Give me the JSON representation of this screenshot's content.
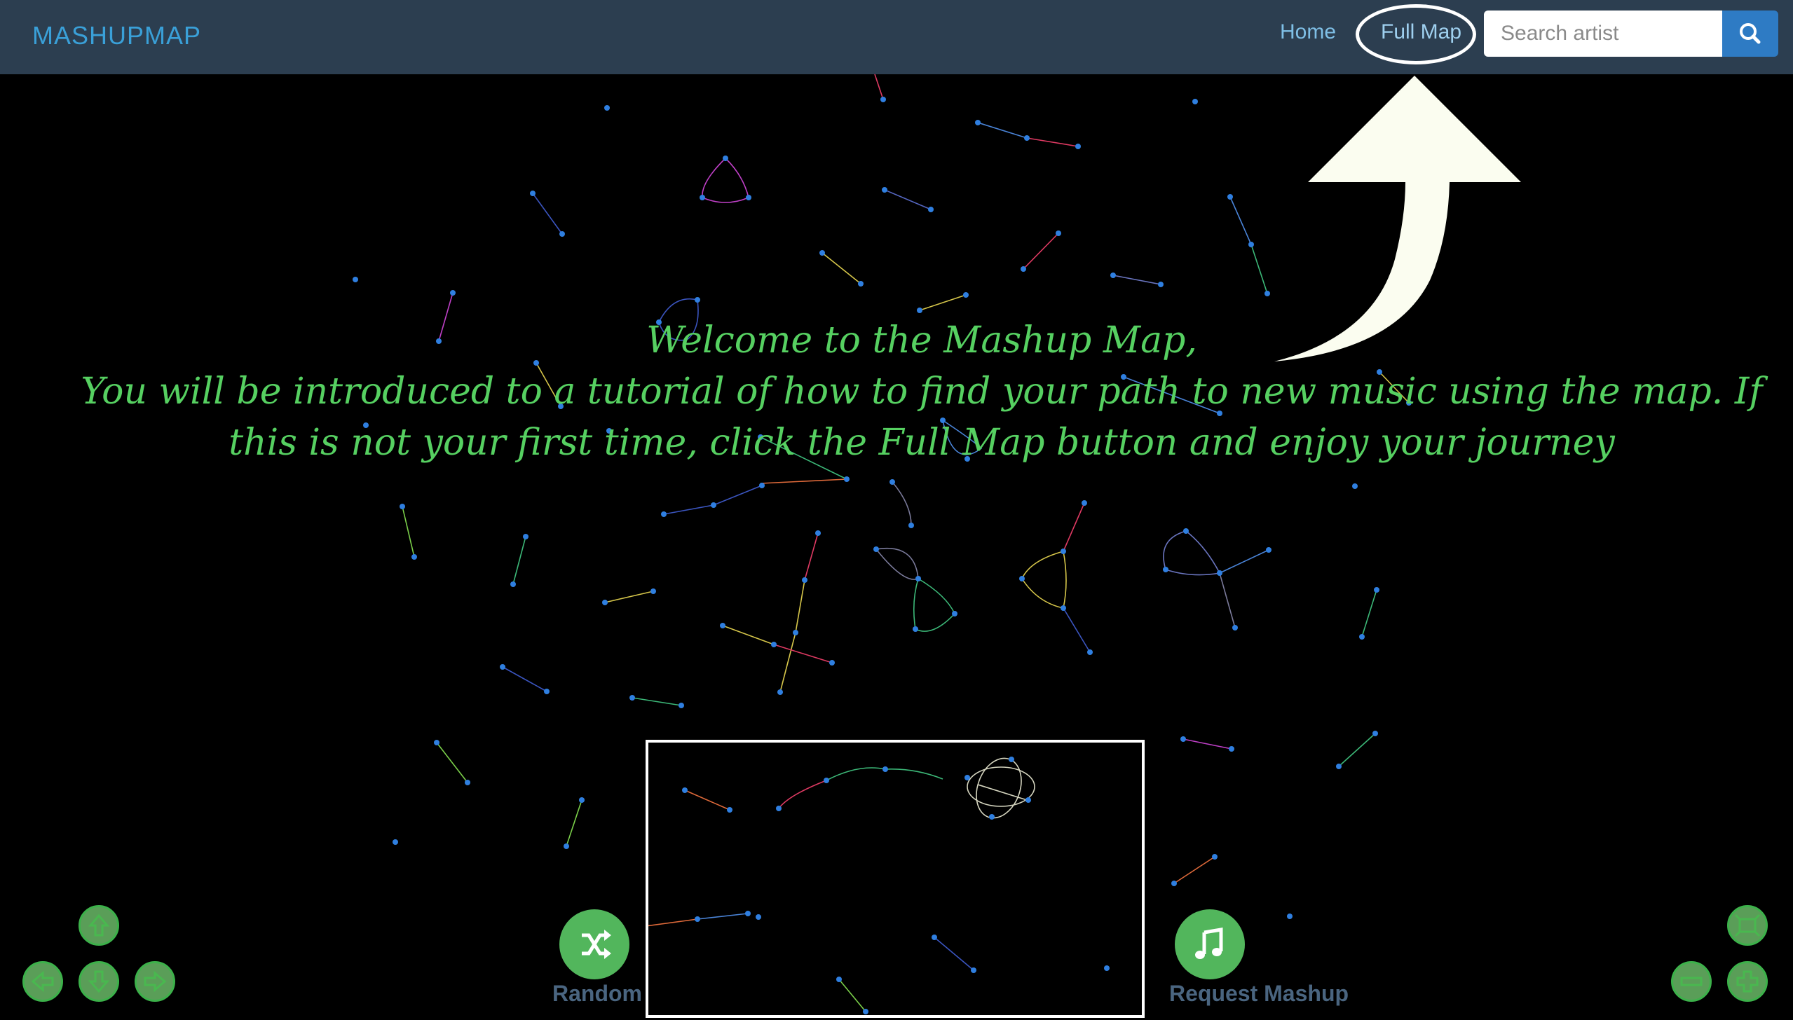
{
  "navbar": {
    "brand": "MASHUPMAP",
    "links": [
      {
        "label": "Home"
      },
      {
        "label": "Full Map"
      }
    ],
    "search": {
      "placeholder": "Search artist",
      "value": ""
    }
  },
  "welcome": {
    "line1": "Welcome to the Mashup Map,",
    "line2": "You will be introduced to a tutorial of how to find your path to new music using the map. If",
    "line3": "this is not your first time, click the Full Map button and enjoy your journey"
  },
  "actions": {
    "random_label": "Random",
    "request_label": "Request Mashup"
  },
  "icons": {
    "search": "search-icon",
    "random": "shuffle-icon",
    "request": "music-note-icon",
    "up": "arrow-up-icon",
    "left": "arrow-left-icon",
    "down": "arrow-down-icon",
    "right": "arrow-right-icon",
    "fit": "fit-screen-icon",
    "zoom_out": "zoom-out-icon",
    "zoom_in": "zoom-in-icon",
    "tutorial_arrow": "curved-arrow-icon"
  },
  "colors": {
    "navbar": "#2c3e50",
    "brand": "#3aa0d8",
    "accent_green": "#52b65c",
    "node_blue": "#2f7fe0",
    "welcome_text": "#56d061",
    "search_button": "#2e7bc4"
  }
}
